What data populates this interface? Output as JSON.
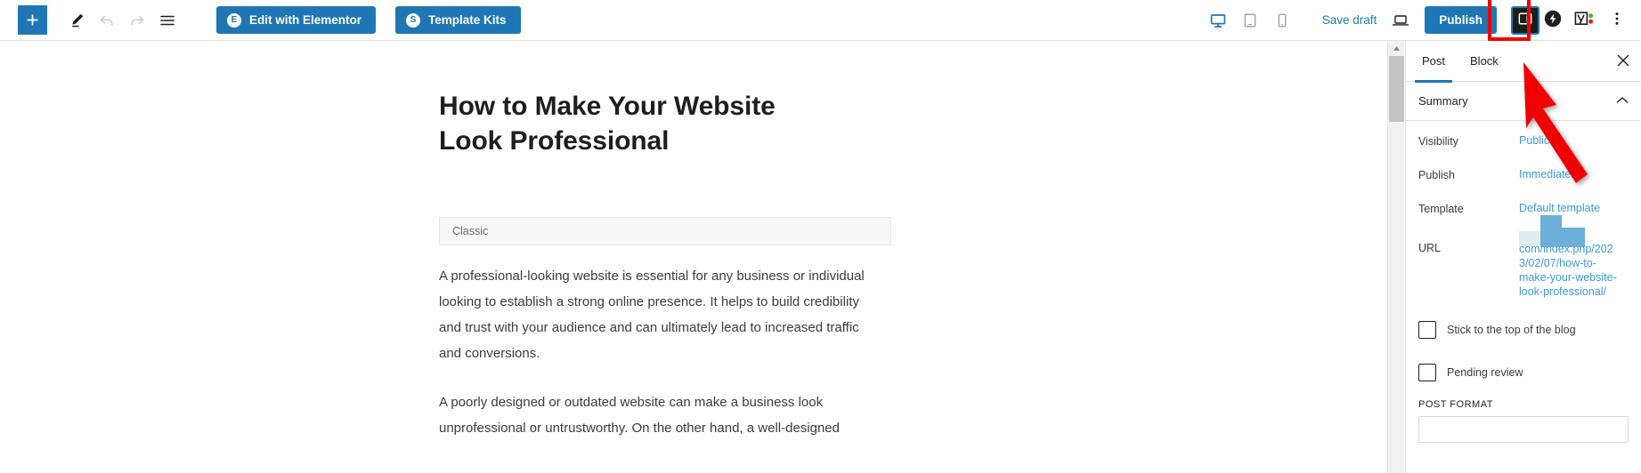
{
  "toolbar": {
    "add_block_label": "+",
    "tools_icon": "pencil-icon",
    "undo_icon": "undo-arrow-icon",
    "redo_icon": "redo-arrow-icon",
    "list_view_icon": "document-outline-icon",
    "elementor_button": "Edit with Elementor",
    "elementor_badge": "E",
    "template_kits_button": "Template Kits",
    "template_kits_badge": "S",
    "device_desktop_icon": "desktop-monitor-icon",
    "device_tablet_icon": "tablet-icon",
    "device_mobile_icon": "mobile-phone-icon",
    "save_draft": "Save draft",
    "preview_icon": "laptop-preview-icon",
    "publish": "Publish",
    "settings_toggle_icon": "settings-sidebar-panel-icon",
    "plugin_icon": "elementor-bolt-icon",
    "yoast_icon": "yoast-seo-icon",
    "more_options_icon": "three-dots-vertical-icon",
    "accent_color": "#1e77b4",
    "highlight_color": "#f00000"
  },
  "editor": {
    "post_title": "How to Make Your Website Look Professional",
    "classic_block_label": "Classic",
    "paragraph_1": "A professional-looking website is essential for any business or individual looking to establish a strong online presence. It helps to build credibility and trust with your audience and can ultimately lead to increased traffic and conversions.",
    "paragraph_2": "A poorly designed or outdated website can make a business look unprofessional or untrustworthy. On the other hand, a well-designed"
  },
  "scrollbar": {
    "up_arrow_icon": "scroll-up-arrow-icon"
  },
  "sidebar": {
    "tabs": [
      {
        "label": "Post",
        "active": true
      },
      {
        "label": "Block",
        "active": false
      }
    ],
    "close_icon": "close-x-icon",
    "summary": {
      "title": "Summary",
      "collapse_icon": "chevron-up-icon",
      "rows": [
        {
          "label": "Visibility",
          "value": "Public"
        },
        {
          "label": "Publish",
          "value": "Immediately"
        },
        {
          "label": "Template",
          "value": "Default template"
        }
      ],
      "url_label": "URL",
      "url_value": "com/index.php/2023/02/07/how-to-make-your-website-look-professional/",
      "url_redacted": true
    },
    "checkboxes": [
      {
        "label": "Stick to the top of the blog",
        "checked": false
      },
      {
        "label": "Pending review",
        "checked": false
      }
    ],
    "post_format_heading": "POST FORMAT",
    "link_color": "#3a9bd9"
  },
  "annotation": {
    "arrow_color": "#f00000",
    "arrow_target": "settings-sidebar-toggle-button"
  }
}
